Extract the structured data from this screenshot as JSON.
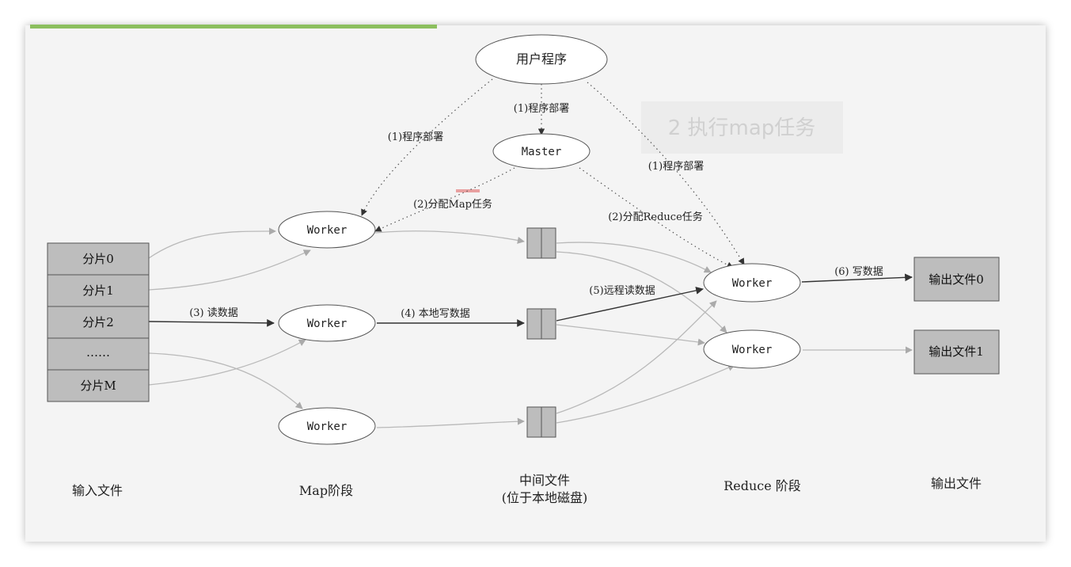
{
  "nodes": {
    "user_program": "用户程序",
    "master": "Master",
    "worker": "Worker"
  },
  "inputs": [
    "分片0",
    "分片1",
    "分片2",
    "……",
    "分片M"
  ],
  "outputs": [
    "输出文件0",
    "输出文件1"
  ],
  "edge_labels": {
    "deploy": "(1)程序部署",
    "assign_map": "(2)分配Map任务",
    "assign_reduce": "(2)分配Reduce任务",
    "read_data": "(3)  读数据",
    "local_write": "(4)  本地写数据",
    "remote_read": "(5)远程读数据",
    "write_data": "(6)  写数据"
  },
  "watermark": "2 执行map任务",
  "stages": {
    "input": "输入文件",
    "map": "Map阶段",
    "intermediate_line1": "中间文件",
    "intermediate_line2": "(位于本地磁盘)",
    "reduce": "Reduce 阶段",
    "output": "输出文件"
  },
  "colors": {
    "accent": "#8cbf5e",
    "box_fill": "#bdbdbd",
    "background": "#f4f4f4"
  }
}
